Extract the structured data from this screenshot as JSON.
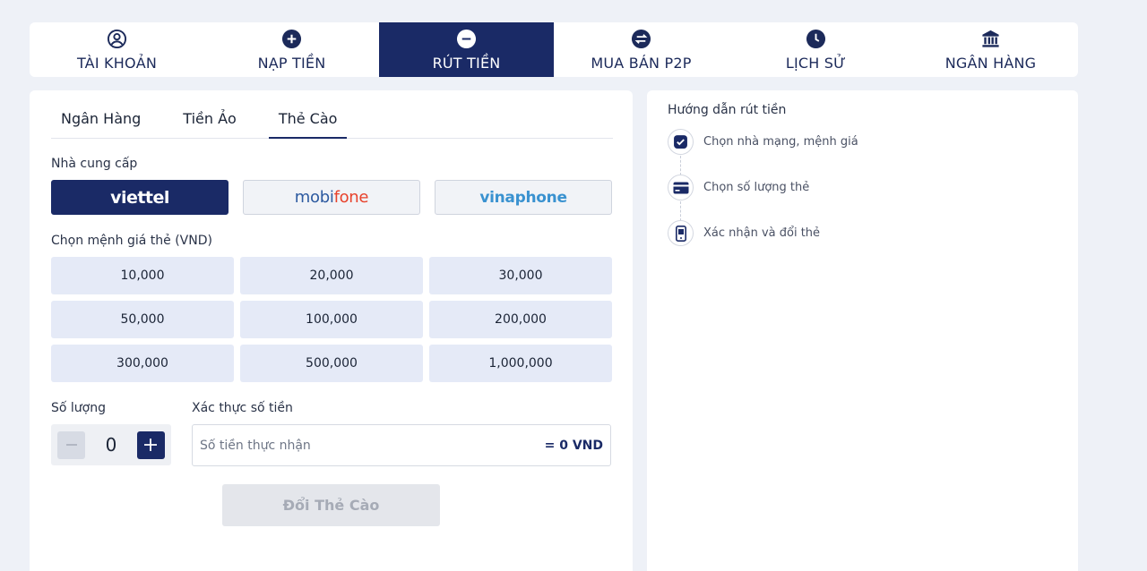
{
  "nav": {
    "tabs": [
      {
        "label": "TÀI KHOẢN",
        "icon": "account-icon"
      },
      {
        "label": "NẠP TIỀN",
        "icon": "plus-circle-icon"
      },
      {
        "label": "RÚT TIỀN",
        "icon": "minus-circle-icon",
        "active": true
      },
      {
        "label": "MUA BÁN P2P",
        "icon": "exchange-icon"
      },
      {
        "label": "LỊCH SỬ",
        "icon": "clock-icon"
      },
      {
        "label": "NGÂN HÀNG",
        "icon": "bank-icon"
      }
    ]
  },
  "subtabs": [
    {
      "label": "Ngân Hàng"
    },
    {
      "label": "Tiền Ảo"
    },
    {
      "label": "Thẻ Cào",
      "active": true
    }
  ],
  "form": {
    "provider_label": "Nhà cung cấp",
    "providers": [
      {
        "name": "viettel",
        "selected": true
      },
      {
        "name": "mobifone",
        "part1": "mobi",
        "part2": "fone"
      },
      {
        "name": "vinaphone"
      }
    ],
    "denomination_label": "Chọn mệnh giá thẻ (VND)",
    "denominations": [
      "10,000",
      "20,000",
      "30,000",
      "50,000",
      "100,000",
      "200,000",
      "300,000",
      "500,000",
      "1,000,000"
    ],
    "quantity_label": "Số lượng",
    "quantity_value": "0",
    "verify_label": "Xác thực số tiền",
    "verify_placeholder": "Số tiền thực nhận",
    "verify_sum": "= 0 VND",
    "submit_label": "Đổi Thẻ Cào"
  },
  "guide": {
    "title": "Hướng dẫn rút tiền",
    "steps": [
      {
        "label": "Chọn nhà mạng, mệnh giá",
        "icon": "checkbox-icon"
      },
      {
        "label": "Chọn số lượng thẻ",
        "icon": "card-icon"
      },
      {
        "label": "Xác nhận và đổi thẻ",
        "icon": "phone-icon"
      }
    ]
  },
  "colors": {
    "primary": "#1a2a66",
    "button_bg": "#e5eaf7",
    "page_bg": "#eef1f7"
  }
}
